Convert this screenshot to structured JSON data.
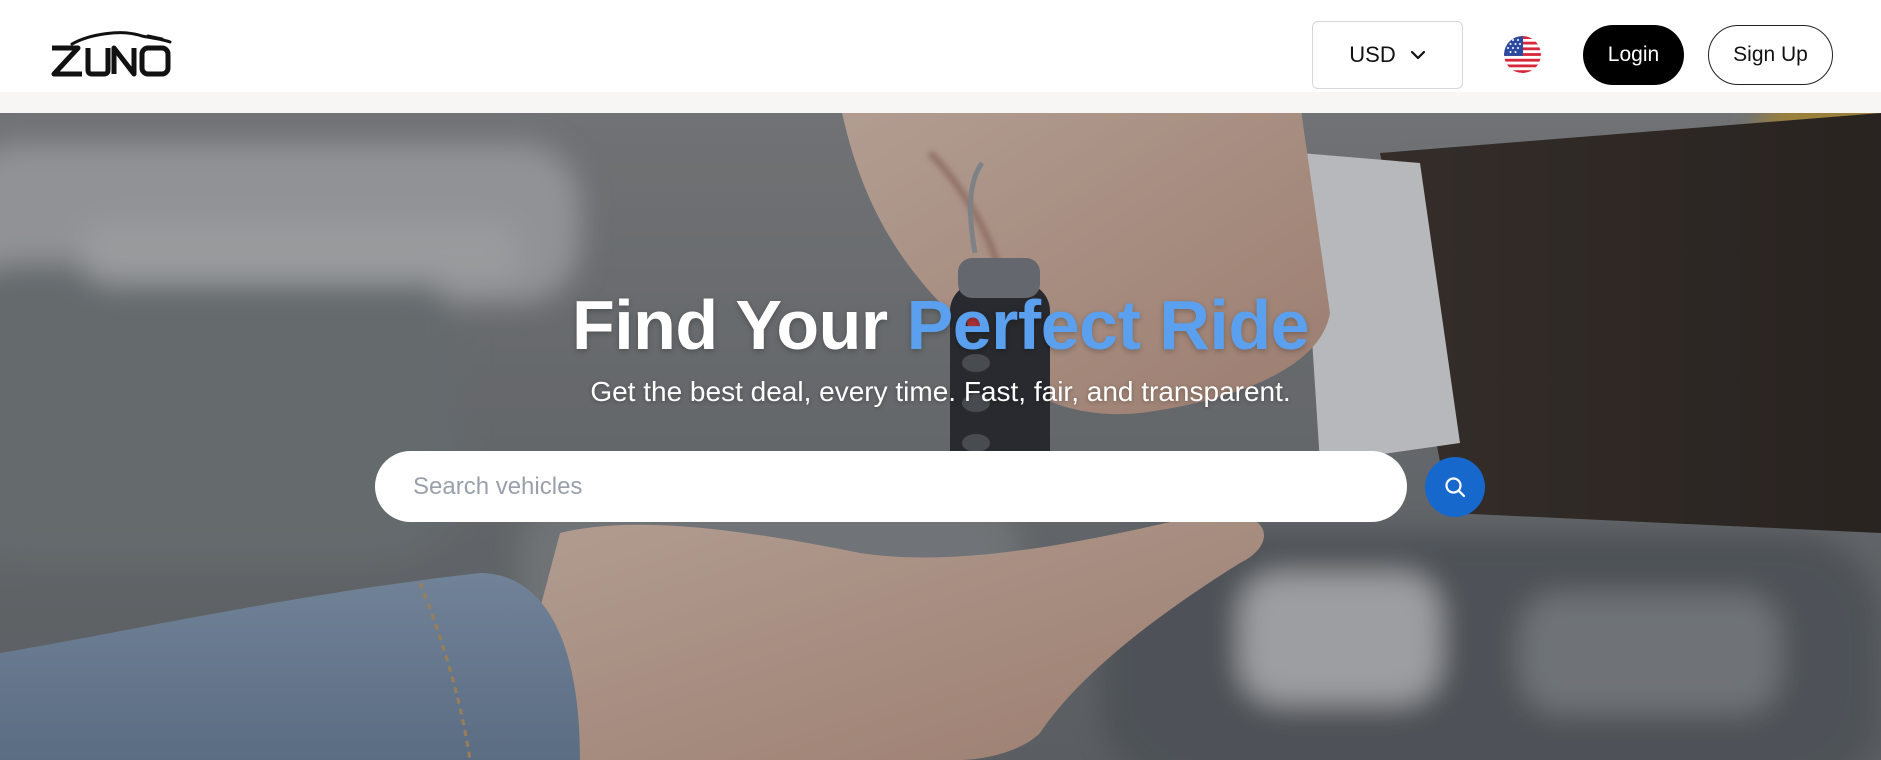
{
  "header": {
    "brand": "ZUNO",
    "currency": {
      "selected": "USD"
    },
    "language_flag": "us-flag-icon",
    "login_label": "Login",
    "signup_label": "Sign Up"
  },
  "hero": {
    "title_part1": "Find Your ",
    "title_part2": "Perfect Ride",
    "subtitle": "Get the best deal, every time. Fast, fair, and transparent.",
    "search": {
      "placeholder": "Search vehicles",
      "value": ""
    }
  },
  "colors": {
    "accent": "#5aa0ee",
    "primary_button": "#1668cc",
    "login_bg": "#000000"
  }
}
